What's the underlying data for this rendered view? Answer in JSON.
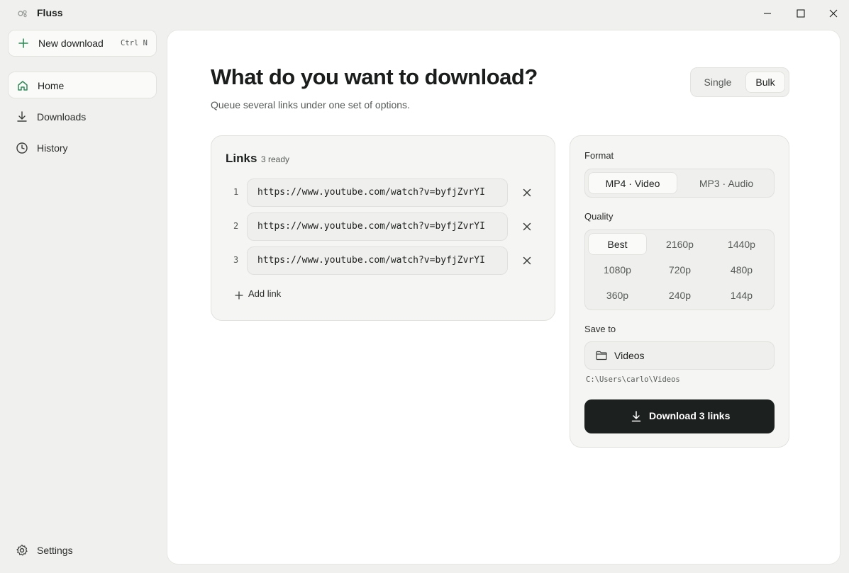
{
  "window": {
    "title": "Fluss",
    "app_icon": "fluss-logo-icon",
    "controls": [
      "minimize-icon",
      "maximize-icon",
      "close-icon"
    ]
  },
  "sidebar": {
    "new_download": {
      "label": "New download",
      "shortcut": "Ctrl N",
      "icon": "plus-icon"
    },
    "items": [
      {
        "label": "Home",
        "icon": "home-icon",
        "active": true
      },
      {
        "label": "Downloads",
        "icon": "download-icon",
        "active": false
      },
      {
        "label": "History",
        "icon": "clock-icon",
        "active": false
      }
    ],
    "settings": {
      "label": "Settings",
      "icon": "gear-icon"
    }
  },
  "main": {
    "title": "What do you want to download?",
    "subtitle": "Queue several links under one set of options.",
    "mode_toggle": {
      "options": [
        "Single",
        "Bulk"
      ],
      "selected": "Bulk"
    }
  },
  "links": {
    "title": "Links",
    "count_label": "3 ready",
    "items": [
      {
        "num": "1",
        "url": "https://www.youtube.com/watch?v=byfjZvrYI"
      },
      {
        "num": "2",
        "url": "https://www.youtube.com/watch?v=byfjZvrYI"
      },
      {
        "num": "3",
        "url": "https://www.youtube.com/watch?v=byfjZvrYI"
      }
    ],
    "add_label": "Add link"
  },
  "options": {
    "format": {
      "label": "Format",
      "options": [
        "MP4 · Video",
        "MP3 · Audio"
      ],
      "selected": "MP4 · Video"
    },
    "quality": {
      "label": "Quality",
      "options": [
        "Best",
        "2160p",
        "1440p",
        "1080p",
        "720p",
        "480p",
        "360p",
        "240p",
        "144p"
      ],
      "selected": "Best"
    },
    "save_to": {
      "label": "Save to",
      "folder": "Videos",
      "path": "C:\\Users\\carlo\\Videos",
      "icon": "folder-icon"
    },
    "download_button": {
      "label": "Download 3 links",
      "icon": "download-icon"
    }
  },
  "colors": {
    "accent": "#2e8b57",
    "primary_button": "#1c211f",
    "background": "#f0f0ee",
    "panel": "#ffffff"
  }
}
